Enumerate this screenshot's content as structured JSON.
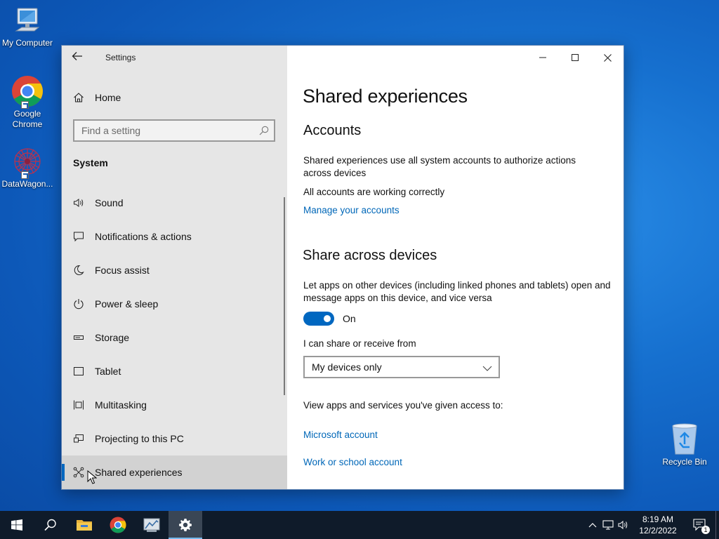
{
  "desktop": {
    "icons": [
      {
        "label": "My Computer"
      },
      {
        "label": "Google Chrome"
      },
      {
        "label": "DataWagon..."
      },
      {
        "label": "Recycle Bin"
      }
    ]
  },
  "window": {
    "app_title": "Settings",
    "controls": {
      "minimize": "minimize-icon",
      "maximize": "maximize-icon",
      "close": "close-icon"
    }
  },
  "sidebar": {
    "home_label": "Home",
    "search_placeholder": "Find a setting",
    "section_label": "System",
    "items": [
      {
        "label": "Sound",
        "icon": "speaker-icon"
      },
      {
        "label": "Notifications & actions",
        "icon": "notifications-icon"
      },
      {
        "label": "Focus assist",
        "icon": "moon-icon"
      },
      {
        "label": "Power & sleep",
        "icon": "power-icon"
      },
      {
        "label": "Storage",
        "icon": "storage-icon"
      },
      {
        "label": "Tablet",
        "icon": "tablet-icon"
      },
      {
        "label": "Multitasking",
        "icon": "multitasking-icon"
      },
      {
        "label": "Projecting to this PC",
        "icon": "projecting-icon"
      },
      {
        "label": "Shared experiences",
        "icon": "shared-experiences-icon",
        "active": true
      }
    ]
  },
  "content": {
    "page_title": "Shared experiences",
    "accounts": {
      "heading": "Accounts",
      "description": "Shared experiences use all system accounts to authorize actions across devices",
      "status": "All accounts are working correctly",
      "manage_link": "Manage your accounts"
    },
    "share": {
      "heading": "Share across devices",
      "description": "Let apps on other devices (including linked phones and tablets) open and message apps on this device, and vice versa",
      "toggle_state": "On",
      "share_from_label": "I can share or receive from",
      "dropdown_value": "My devices only",
      "access_label": "View apps and services you've given access to:",
      "microsoft_link": "Microsoft account",
      "work_link": "Work or school account"
    }
  },
  "taskbar": {
    "time": "8:19 AM",
    "date": "12/2/2022",
    "notification_count": "1",
    "accent_color": "#0067c0"
  }
}
